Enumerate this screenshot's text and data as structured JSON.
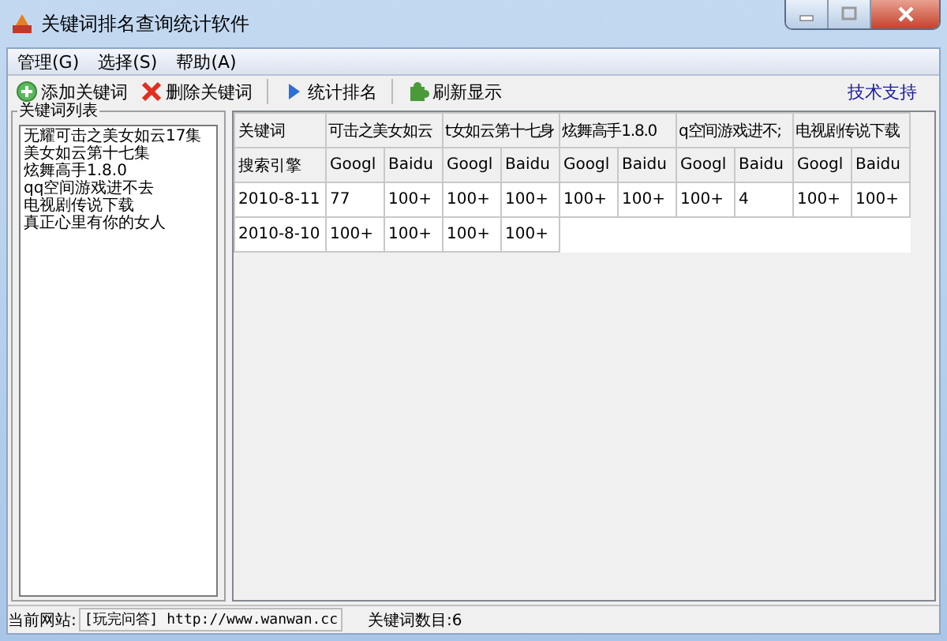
{
  "window": {
    "title": "关键词排名查询统计软件"
  },
  "menu": [
    "管理(G)",
    "选择(S)",
    "帮助(A)"
  ],
  "toolbar": [
    {
      "label": "添加关键词",
      "kind": "add"
    },
    {
      "label": "删除关键词",
      "kind": "delete"
    },
    {
      "label": "统计排名",
      "kind": "play"
    },
    {
      "label": "刷新显示",
      "kind": "puzzle"
    }
  ],
  "support_link": "技术支持",
  "keyword_list": {
    "title": "关键词列表",
    "items": [
      "无耀可击之美女如云17集",
      "美女如云第十七集",
      "炫舞高手1.8.0",
      "qq空间游戏进不去",
      "电视剧传说下载",
      "真正心里有你的女人"
    ]
  },
  "table": {
    "keyword_label": "关键词",
    "engine_label": "搜索引擎",
    "keywords": [
      "可击之美女如云",
      "t女如云第十七身",
      "炫舞高手1.8.0",
      "q空间游戏进不;",
      "电视剧传说下载"
    ],
    "engines": [
      "Googl",
      "Baidu",
      "Googl",
      "Baidu",
      "Googl",
      "Baidu",
      "Googl",
      "Baidu",
      "Googl",
      "Baidu"
    ],
    "rows": [
      {
        "date": "2010-8-11",
        "values": [
          "77",
          "100+",
          "100+",
          "100+",
          "100+",
          "100+",
          "100+",
          "4",
          "100+",
          "100+"
        ]
      },
      {
        "date": "2010-8-10",
        "values": [
          "100+",
          "100+",
          "100+",
          "100+"
        ]
      }
    ]
  },
  "status_bar": {
    "site_label": "当前网站:",
    "site": "[玩完问答] http://www.wanwan.cc",
    "count": "关键词数目:6"
  }
}
